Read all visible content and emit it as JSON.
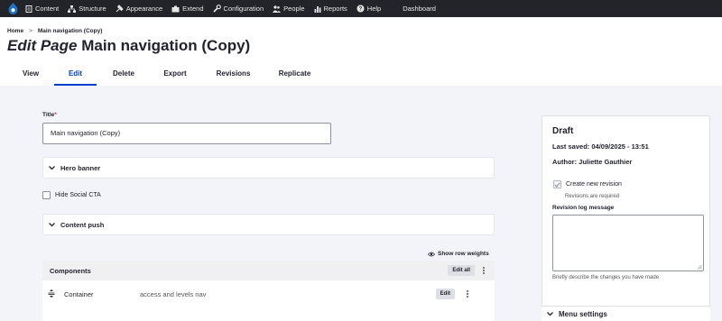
{
  "toolbar": {
    "items": [
      {
        "label": "Content",
        "icon": "content-icon"
      },
      {
        "label": "Structure",
        "icon": "structure-icon"
      },
      {
        "label": "Appearance",
        "icon": "appearance-icon"
      },
      {
        "label": "Extend",
        "icon": "extend-icon"
      },
      {
        "label": "Configuration",
        "icon": "configuration-icon"
      },
      {
        "label": "People",
        "icon": "people-icon"
      },
      {
        "label": "Reports",
        "icon": "reports-icon"
      },
      {
        "label": "Help",
        "icon": "help-icon"
      },
      {
        "label": "Dashboard",
        "icon": ""
      }
    ],
    "colors": {
      "background": "#232429",
      "logo": "#1e73c8"
    }
  },
  "breadcrumb": {
    "home": "Home",
    "separator": ">",
    "current": "Main navigation (Copy)"
  },
  "page": {
    "title_prefix": "Edit Page",
    "title": "Main navigation (Copy)"
  },
  "tabs": [
    {
      "label": "View",
      "active": false
    },
    {
      "label": "Edit",
      "active": true
    },
    {
      "label": "Delete",
      "active": false
    },
    {
      "label": "Export",
      "active": false
    },
    {
      "label": "Revisions",
      "active": false
    },
    {
      "label": "Replicate",
      "active": false
    }
  ],
  "form": {
    "title_label": "Title",
    "required_mark": "*",
    "title_value": "Main navigation (Copy)",
    "hero_banner": "Hero banner",
    "hide_social_cta": "Hide Social CTA",
    "content_push": "Content push",
    "show_row_weights": "Show row weights"
  },
  "components": {
    "heading": "Components",
    "edit_all": "Edit all",
    "rows": [
      {
        "name": "Container",
        "summary": "access and levels nav",
        "edit": "Edit"
      }
    ]
  },
  "sidebar": {
    "status": "Draft",
    "last_saved_label": "Last saved:",
    "last_saved_value": "04/09/2025 - 13:51",
    "author_label": "Author:",
    "author_value": "Juliette Gauthier",
    "create_revision": "Create new revision",
    "revisions_required": "Revisions are required",
    "revision_log_label": "Revision log message",
    "revision_log_help": "Briefly describe the changes you have made",
    "menu_settings": "Menu settings"
  },
  "colors": {
    "accent": "#003ecc",
    "required": "#dc2323"
  }
}
